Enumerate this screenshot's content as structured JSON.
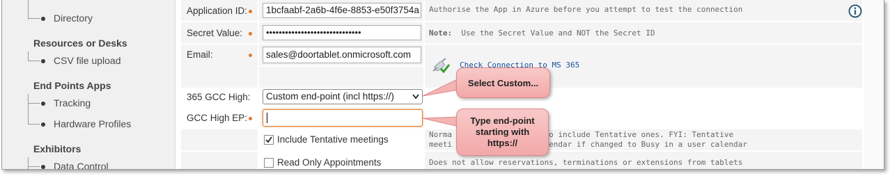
{
  "sidebar": {
    "items": [
      {
        "label": "Directory"
      },
      {
        "label": "CSV file upload"
      },
      {
        "label": "Tracking"
      },
      {
        "label": "Hardware Profiles"
      },
      {
        "label": "Data Control"
      }
    ],
    "headings": [
      "Resources or Desks",
      "End Points Apps",
      "Exhibitors"
    ]
  },
  "form": {
    "app_id": {
      "label": "Application ID:",
      "value": "1bcfaabf-2a6b-4f6e-8853-e50f3754a",
      "note": "Authorise the App in Azure before you attempt to test the connection"
    },
    "secret": {
      "label": "Secret Value:",
      "value": "••••••••••••••••••••••••••••••",
      "note_bold": "Note:",
      "note": "Use the Secret Value and NOT the Secret ID"
    },
    "email": {
      "label": "Email:",
      "value": "sales@doortablet.onmicrosoft.com"
    },
    "check_connection": "Check Connection to MS 365",
    "gcc": {
      "label": "365 GCC High:",
      "selected": "Custom end-point (incl https://)"
    },
    "gcc_ep": {
      "label": "GCC High EP:",
      "value": ""
    },
    "tentative": {
      "label": "Include Tentative meetings",
      "checked": true,
      "note_line1": "Norma                   gs only. Tick this to include Tentative ones. FYI: Tentative",
      "note_line2": "meeti                   Busy in the room calendar if changed to Busy in a user calendar"
    },
    "readonly": {
      "label": "Read Only Appointments",
      "checked": false,
      "note": "Does not allow reservations, terminations or extensions from tablets"
    }
  },
  "callouts": {
    "select_custom": "Select Custom...",
    "type_endpoint": "Type end-point starting with https://"
  },
  "colors": {
    "accent_dot": "#e07a2e",
    "link": "#1a4f9c",
    "callout": "#f4b4b4"
  }
}
